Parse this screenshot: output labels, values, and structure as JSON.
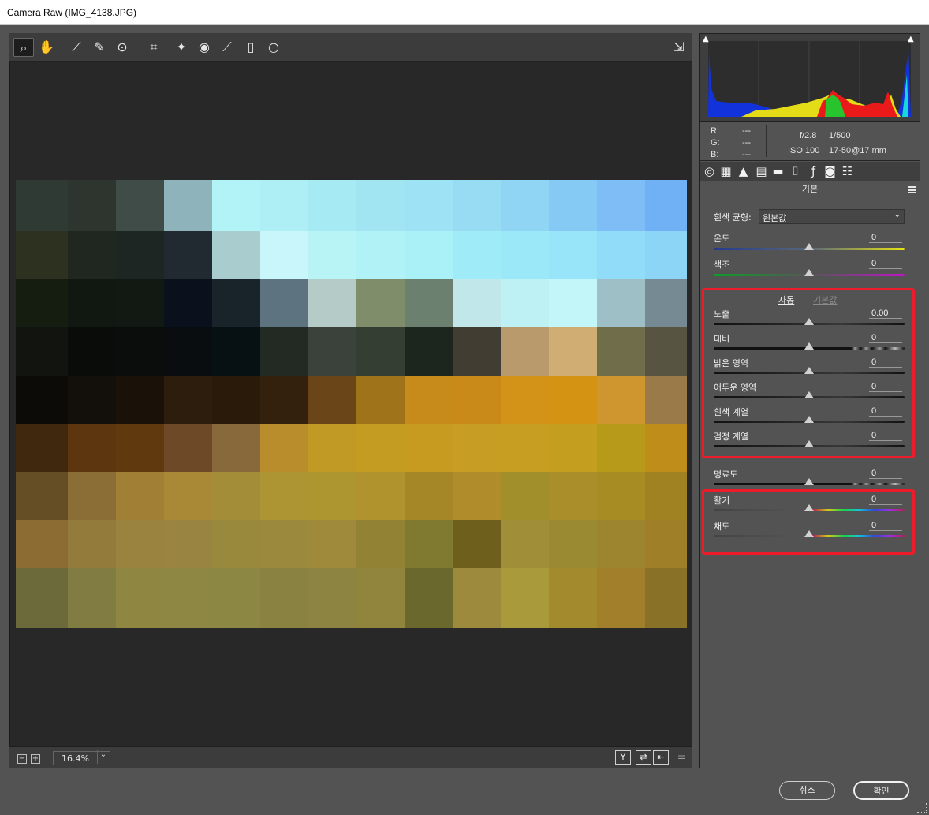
{
  "window": {
    "title": "Camera Raw (IMG_4138.JPG)"
  },
  "toolbar": {
    "tools": [
      {
        "name": "zoom-tool",
        "icon": "⌕"
      },
      {
        "name": "hand-tool",
        "icon": "✋"
      },
      {
        "name": "white-balance-tool",
        "icon": "⟋"
      },
      {
        "name": "color-sampler-tool",
        "icon": "✎"
      },
      {
        "name": "targeted-adjustment-tool",
        "icon": "⊙"
      },
      {
        "name": "crop-tool",
        "icon": "⌗"
      },
      {
        "name": "spot-removal-tool",
        "icon": "✦"
      },
      {
        "name": "red-eye-tool",
        "icon": "◉"
      },
      {
        "name": "adjustment-brush-tool",
        "icon": "⟋"
      },
      {
        "name": "graduated-filter-tool",
        "icon": "▯"
      },
      {
        "name": "radial-filter-tool",
        "icon": "○"
      }
    ],
    "export_icon": "⇲"
  },
  "viewer": {
    "zoom": "16.4%"
  },
  "histogram": {
    "rgb": [
      {
        "label": "R:",
        "value": "---"
      },
      {
        "label": "G:",
        "value": "---"
      },
      {
        "label": "B:",
        "value": "---"
      }
    ],
    "camera": [
      "f/2.8",
      "1/500",
      "ISO 100",
      "17-50@17 mm"
    ]
  },
  "panel": {
    "title": "기본",
    "white_balance_label": "흰색 균형:",
    "white_balance_value": "원본값",
    "auto": "자동",
    "default": "기본값",
    "sliders": [
      {
        "id": "temperature",
        "label": "온도",
        "value": "0",
        "level": 0.5
      },
      {
        "id": "tint",
        "label": "색조",
        "value": "0",
        "level": 0.5
      },
      {
        "id": "exposure",
        "label": "노출",
        "value": "0.00",
        "level": 0.5
      },
      {
        "id": "contrast",
        "label": "대비",
        "value": "0",
        "level": 0.5
      },
      {
        "id": "highlights",
        "label": "밝은 영역",
        "value": "0",
        "level": 0.5
      },
      {
        "id": "shadows",
        "label": "어두운 영역",
        "value": "0",
        "level": 0.5
      },
      {
        "id": "whites",
        "label": "흰색 계열",
        "value": "0",
        "level": 0.5
      },
      {
        "id": "blacks",
        "label": "검정 계열",
        "value": "0",
        "level": 0.5
      },
      {
        "id": "clarity",
        "label": "명료도",
        "value": "0",
        "level": 0.5
      },
      {
        "id": "vibrance",
        "label": "활기",
        "value": "0",
        "level": 0.5
      },
      {
        "id": "saturation",
        "label": "채도",
        "value": "0",
        "level": 0.5
      }
    ]
  },
  "footer": {
    "cancel": "취소",
    "ok": "확인"
  },
  "photo_colors": [
    "#2f3a35",
    "#2d352e",
    "#3f4c47",
    "#8fb3bb",
    "#b2f3f7",
    "#aeeff6",
    "#a6eaf4",
    "#a1e4f2",
    "#9de2f5",
    "#98dcf3",
    "#91d5f5",
    "#84caf5",
    "#7ebdf6",
    "#6fb1f4",
    "#69adf3",
    "#2c321f",
    "#1f2720",
    "#1d2622",
    "#212a31",
    "#a9ccce",
    "#c9f6fa",
    "#b8f3f6",
    "#b0f2f6",
    "#a9f0f7",
    "#a0ebf8",
    "#9be8f8",
    "#98e4f9",
    "#91dcf9",
    "#8cd5f7",
    "#87d2f6",
    "#151d10",
    "#111711",
    "#121812",
    "#0b111c",
    "#19242a",
    "#5d7480",
    "#b5cbc8",
    "#7f8d6a",
    "#6b806f",
    "#c2e7eb",
    "#bdf1f4",
    "#c2f6f8",
    "#9ebfc6",
    "#758a93",
    "#6f8690",
    "#11140f",
    "#0a0c0a",
    "#0b0d0c",
    "#090d0f",
    "#071013",
    "#222a23",
    "#3b423b",
    "#353e32",
    "#1d251f",
    "#423d33",
    "#b89a6c",
    "#d0ae73",
    "#706d4b",
    "#575542",
    "#4f4f3b",
    "#0d0b08",
    "#130f0a",
    "#1a1209",
    "#2d1d0c",
    "#2a1a0a",
    "#33200d",
    "#6a4517",
    "#9e7319",
    "#c68b1a",
    "#ca8a1a",
    "#d39218",
    "#d49313",
    "#cf962f",
    "#9b7a49",
    "#957542",
    "#40280f",
    "#5d350f",
    "#61390f",
    "#6d4928",
    "#87693c",
    "#b98d2c",
    "#c19a25",
    "#c59c22",
    "#c79b20",
    "#c89d23",
    "#c79d22",
    "#c49e1f",
    "#b89a1b",
    "#be8d1a",
    "#b98a19",
    "#654d25",
    "#8a6e35",
    "#a17f35",
    "#a98936",
    "#a48d39",
    "#ad9534",
    "#ad9630",
    "#b1932e",
    "#a68728",
    "#b08d2a",
    "#a18f2c",
    "#aa8e29",
    "#a68c23",
    "#a18222",
    "#9e7f20",
    "#8c6c33",
    "#937c3b",
    "#9a823f",
    "#998441",
    "#98893d",
    "#9b8a3d",
    "#9f893a",
    "#928234",
    "#807a30",
    "#6f5f1d",
    "#a08e38",
    "#9a8a32",
    "#9d852f",
    "#9f7f28",
    "#9a7b26",
    "#6c6a3b",
    "#817d42",
    "#8e8641",
    "#8e8643",
    "#8d8744",
    "#8a8240",
    "#8d8442",
    "#91853d",
    "#6a682c",
    "#9e8a3d",
    "#a99a3b",
    "#a38a2d",
    "#a27f2a",
    "#8a7128",
    "#8a6f25"
  ]
}
